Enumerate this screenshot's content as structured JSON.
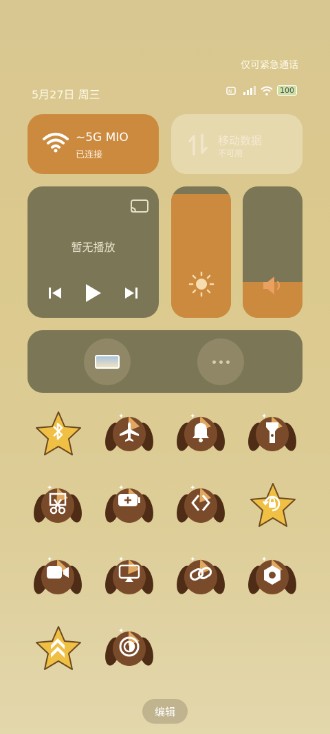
{
  "status_bar": {
    "emergency_text": "仅可紧急通话",
    "date_text": "5月27日 周三",
    "battery_text": "100"
  },
  "wifi": {
    "name": "~5G MIO",
    "status": "已连接"
  },
  "mobile_data": {
    "name": "移动数据",
    "status": "不可用"
  },
  "media": {
    "status": "暂无播放"
  },
  "sliders": {
    "brightness_level": 0.94,
    "volume_level": 0.27
  },
  "grid": [
    {
      "name": "bluetooth",
      "icon": "bluetooth-icon",
      "style": "star"
    },
    {
      "name": "airplane",
      "icon": "airplane-icon",
      "style": "dog"
    },
    {
      "name": "ring",
      "icon": "bell-icon",
      "style": "dog"
    },
    {
      "name": "flashlight",
      "icon": "flashlight-icon",
      "style": "dog"
    },
    {
      "name": "screenshot",
      "icon": "scissors-icon",
      "style": "dog"
    },
    {
      "name": "battery-saver",
      "icon": "battery-plus-icon",
      "style": "dog"
    },
    {
      "name": "nearby-share",
      "icon": "share-icon",
      "style": "dog"
    },
    {
      "name": "rotation-lock",
      "icon": "rotation-lock-icon",
      "style": "star"
    },
    {
      "name": "screen-record",
      "icon": "video-icon",
      "style": "dog"
    },
    {
      "name": "cast",
      "icon": "cast-screen-icon",
      "style": "dog"
    },
    {
      "name": "hotspot",
      "icon": "link-icon",
      "style": "dog"
    },
    {
      "name": "nfc",
      "icon": "hexagon-icon",
      "style": "dog"
    },
    {
      "name": "performance",
      "icon": "chevrons-up-icon",
      "style": "star"
    },
    {
      "name": "dark-mode",
      "icon": "contrast-icon",
      "style": "dog"
    }
  ],
  "edit_label": "编辑",
  "colors": {
    "accent": "#cc8a3e",
    "tile": "#7b7655",
    "dog_head": "#7a4b2a",
    "star": "#efc044"
  }
}
